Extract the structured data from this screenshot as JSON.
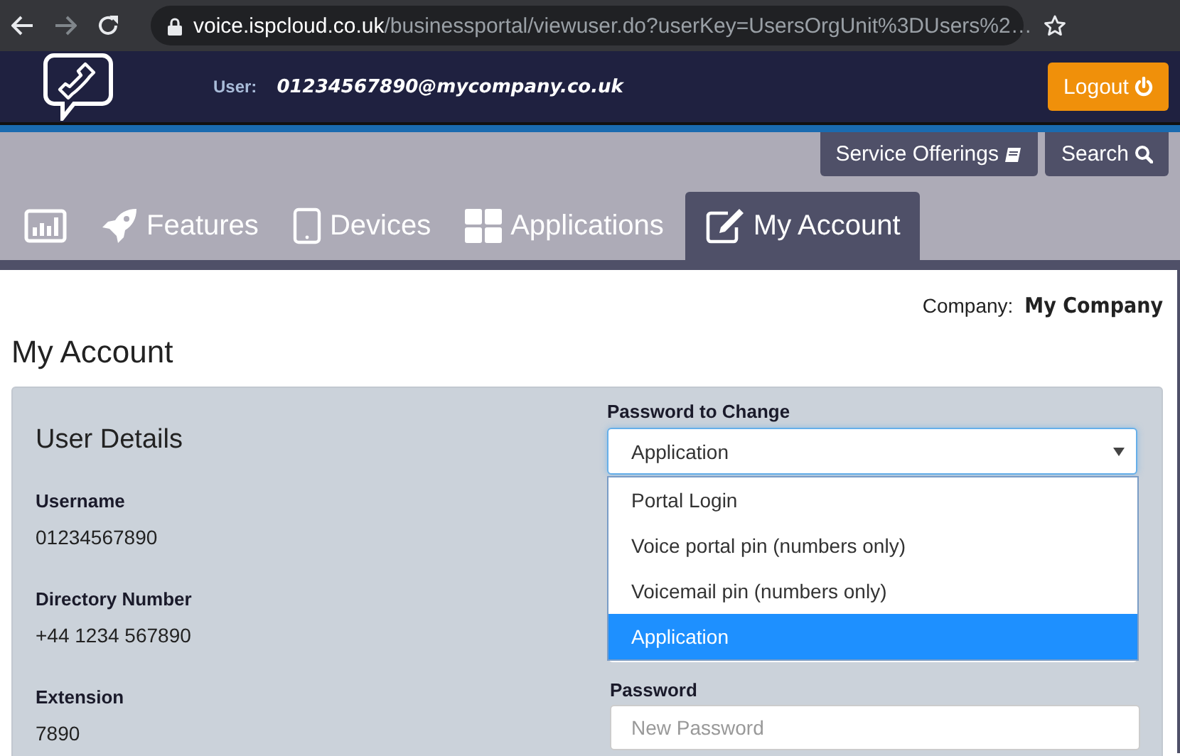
{
  "browser": {
    "url_host": "voice.ispcloud.co.uk",
    "url_path": "/businessportal/viewuser.do?userKey=UsersOrgUnit%3DUsers%2…"
  },
  "header": {
    "user_label": "User:",
    "user_email": "01234567890@mycompany.co.uk",
    "logout": "Logout"
  },
  "actions": [
    {
      "label": "Service Offerings"
    },
    {
      "label": "Search"
    }
  ],
  "tabs": [
    {
      "selected": false
    },
    {
      "label": "Features",
      "selected": false
    },
    {
      "label": "Devices",
      "selected": false
    },
    {
      "label": "Applications",
      "selected": false
    },
    {
      "label": "My Account",
      "selected": true
    }
  ],
  "company": {
    "label": "Company:",
    "name": "My Company"
  },
  "page_title": "My Account",
  "user_details": {
    "title": "User Details",
    "fields": [
      {
        "label": "Username",
        "value": "01234567890"
      },
      {
        "label": "Directory Number",
        "value": "+44 1234 567890"
      },
      {
        "label": "Extension",
        "value": "7890"
      }
    ]
  },
  "password_form": {
    "select_label": "Password to Change",
    "select_value": "Application",
    "expanded": true,
    "options": [
      {
        "label": "Portal Login",
        "selected": false
      },
      {
        "label": "Voice portal pin (numbers only)",
        "selected": false
      },
      {
        "label": "Voicemail pin (numbers only)",
        "selected": false
      },
      {
        "label": "Application",
        "selected": true
      }
    ],
    "password_label": "Password",
    "password_placeholder": "New Password"
  }
}
